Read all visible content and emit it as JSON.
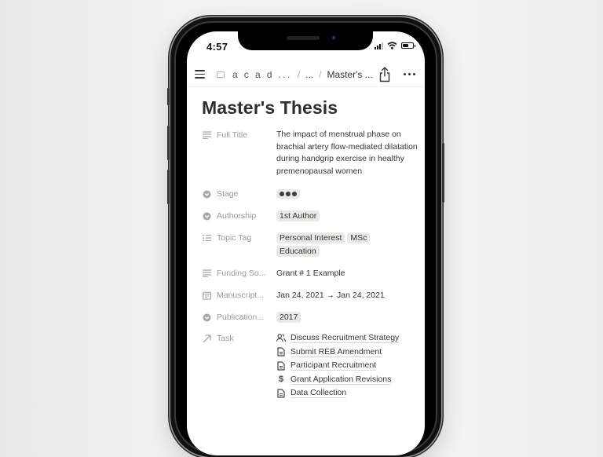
{
  "status_bar": {
    "time": "4:57"
  },
  "navbar": {
    "breadcrumb": [
      "a c a d ...",
      "...",
      "Master's ..."
    ],
    "separator": "/"
  },
  "page": {
    "title": "Master's Thesis",
    "properties": [
      {
        "name": "Full Title",
        "icon": "text-lines-icon",
        "value": "The impact of menstrual phase on brachial artery flow-mediated dilatation during handgrip exercise in healthy premenopausal women"
      },
      {
        "name": "Stage",
        "icon": "select-icon",
        "tags": [
          "●●●"
        ]
      },
      {
        "name": "Authorship",
        "icon": "select-icon",
        "tags": [
          "1st Author"
        ]
      },
      {
        "name": "Topic Tag",
        "icon": "multi-select-icon",
        "tags": [
          "Personal Interest",
          "MSc",
          "Education"
        ]
      },
      {
        "name": "Funding So...",
        "icon": "text-lines-icon",
        "value": "Grant # 1 Example"
      },
      {
        "name": "Manuscript...",
        "icon": "calendar-icon",
        "value": "Jan 24, 2021 → Jan 24, 2021"
      },
      {
        "name": "Publication...",
        "icon": "select-icon",
        "tags": [
          "2017"
        ]
      },
      {
        "name": "Task",
        "icon": "relation-arrow-icon",
        "tasks": [
          {
            "icon": "people-icon",
            "label": "Discuss Recruitment Strategy"
          },
          {
            "icon": "document-icon",
            "label": "Submit REB Amendment"
          },
          {
            "icon": "document-icon",
            "label": "Participant Recruitment"
          },
          {
            "icon": "dollar-icon",
            "label": "Grant Application Revisions"
          },
          {
            "icon": "document-icon",
            "label": "Data Collection"
          }
        ]
      }
    ]
  },
  "colors": {
    "text": "#37352f",
    "muted": "#9b9a97",
    "tag_bg": "#e9e9e7",
    "camera": "#1d3f8f"
  }
}
